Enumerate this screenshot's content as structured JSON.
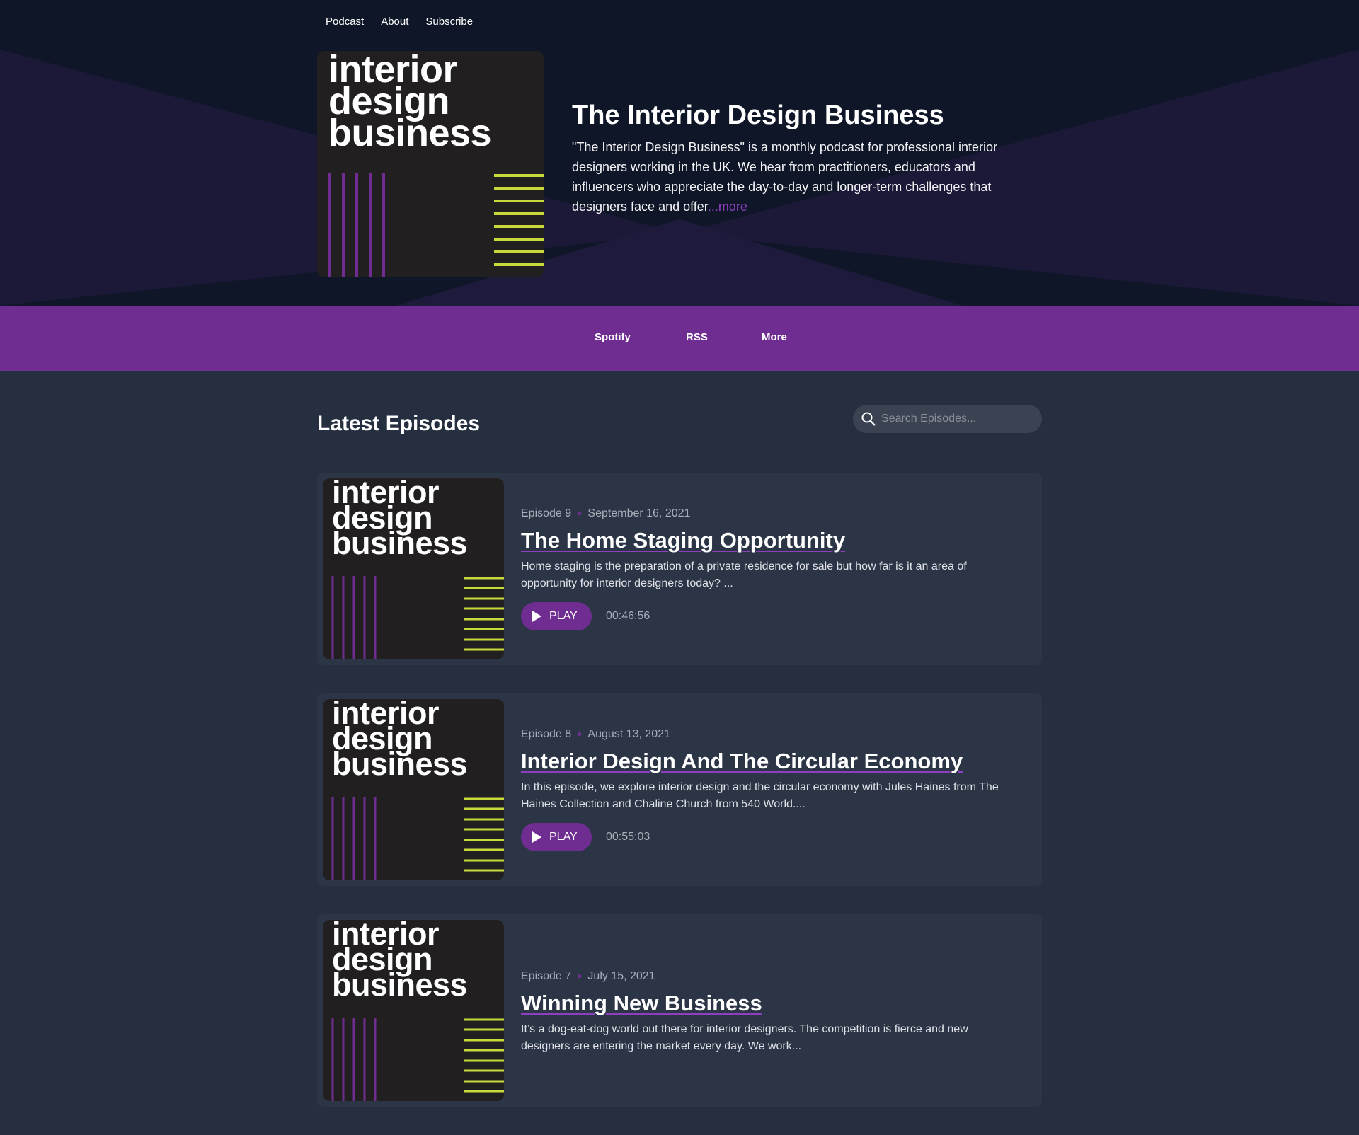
{
  "nav": {
    "podcast": "Podcast",
    "about": "About",
    "subscribe": "Subscribe"
  },
  "cover_art": {
    "text": "interior\ndesign\nbusiness",
    "colors": {
      "background": "#221f20",
      "stripes_purple": "#6f2d91",
      "stripes_lime": "#c8d93a"
    }
  },
  "podcast": {
    "title": "The Interior Design Business",
    "description": "\"The Interior Design Business\" is a monthly podcast for professional interior designers working in the UK. We hear from practitioners, educators and influencers who appreciate the day-to-day and longer-term challenges that designers face and offer",
    "more_label": "...more"
  },
  "platforms": {
    "spotify": "Spotify",
    "rss": "RSS",
    "more": "More"
  },
  "episodes_section": {
    "title": "Latest Episodes",
    "search_placeholder": "Search Episodes..."
  },
  "episodes": [
    {
      "number": "Episode 9",
      "date": "September 16, 2021",
      "title": "The Home Staging Opportunity",
      "description": "Home staging is the preparation of a private residence for sale but how far is it an area of opportunity for interior designers today?    ...",
      "play_label": "PLAY",
      "duration": "00:46:56"
    },
    {
      "number": "Episode 8",
      "date": "August 13, 2021",
      "title": "Interior Design And The Circular Economy",
      "description": "In this episode, we explore interior design and the circular economy with Jules Haines from The Haines Collection and Chaline Church from 540 World....",
      "play_label": "PLAY",
      "duration": "00:55:03"
    },
    {
      "number": "Episode 7",
      "date": "July 15, 2021",
      "title": "Winning New Business",
      "description": "It’s a dog-eat-dog world out there for interior designers. The competition is fierce and new designers are entering the market every day. We work..."
    }
  ],
  "colors": {
    "accent": "#6f2d91",
    "link_accent": "#8e3fc0",
    "hero_bg": "#0f1627",
    "page_bg": "#252f40",
    "card_bg": "#2c3546"
  }
}
